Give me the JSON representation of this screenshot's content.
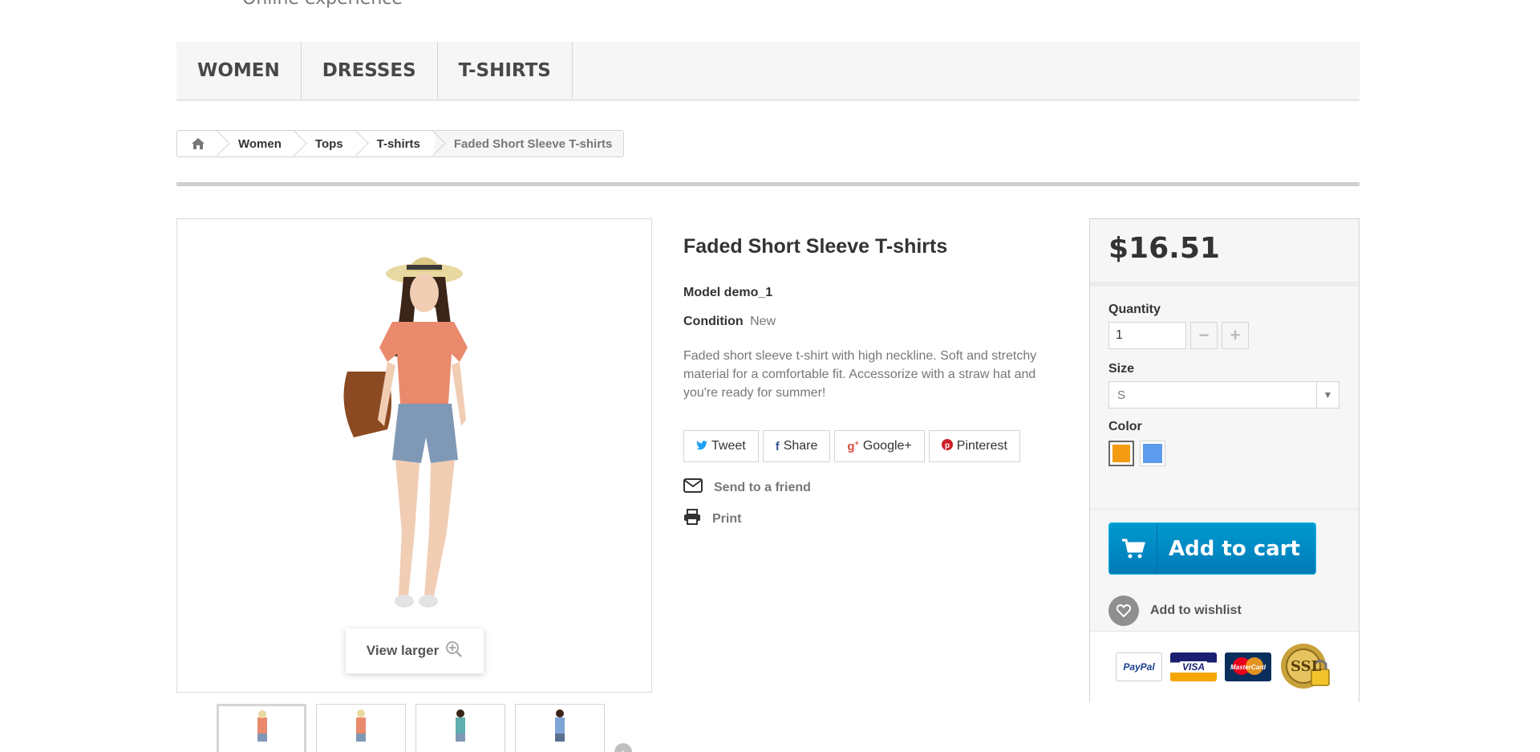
{
  "header": {
    "tagline": "Online experience"
  },
  "menu": {
    "items": [
      {
        "label": "WOMEN"
      },
      {
        "label": "DRESSES"
      },
      {
        "label": "T-SHIRTS"
      }
    ]
  },
  "breadcrumb": {
    "items": [
      "Women",
      "Tops",
      "T-shirts"
    ],
    "current": "Faded Short Sleeve T-shirts"
  },
  "product": {
    "title": "Faded Short Sleeve T-shirts",
    "model": "Model demo_1",
    "condition_label": "Condition",
    "condition_value": "New",
    "description": "Faded short sleeve t-shirt with high neckline. Soft and stretchy material for a comfortable fit. Accessorize with a straw hat and you're ready for summer!",
    "view_larger": "View larger"
  },
  "social": {
    "tweet": "Tweet",
    "share": "Share",
    "google": "Google+",
    "pinterest": "Pinterest"
  },
  "actions": {
    "send_friend": "Send to a friend",
    "print": "Print"
  },
  "buy": {
    "price": "$16.51",
    "quantity_label": "Quantity",
    "quantity_value": "1",
    "size_label": "Size",
    "size_value": "S",
    "color_label": "Color",
    "colors": [
      "#f39c11",
      "#5d9cec"
    ],
    "add_to_cart": "Add to cart",
    "add_to_wishlist": "Add to wishlist"
  },
  "payment": {
    "paypal": "PayPal",
    "visa": "VISA",
    "mastercard": "MasterCard",
    "ssl": "SSL"
  }
}
